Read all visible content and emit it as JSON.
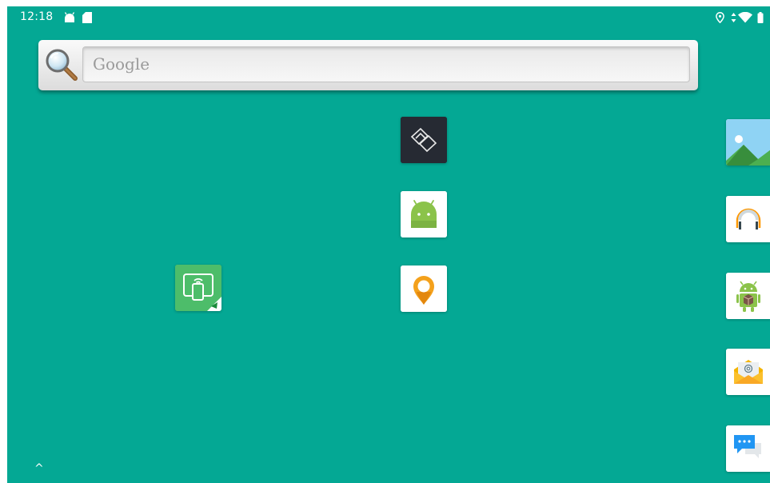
{
  "status_bar": {
    "time": "12:18",
    "left_icons": [
      "android-notification-icon",
      "sd-card-icon"
    ],
    "right_icons": [
      "location-icon",
      "data-arrows-icon",
      "wifi-icon",
      "battery-icon"
    ]
  },
  "search": {
    "placeholder": "Google",
    "icon": "magnifier-icon"
  },
  "apps": [
    {
      "icon": "mirror-squares-icon"
    },
    {
      "icon": "android-robot-icon"
    },
    {
      "icon": "screen-cast-icon"
    },
    {
      "icon": "map-pin-icon"
    }
  ],
  "dock": [
    {
      "icon": "gallery-icon"
    },
    {
      "icon": "headphones-icon"
    },
    {
      "icon": "android-package-icon"
    },
    {
      "icon": "email-icon"
    },
    {
      "icon": "messaging-icon"
    }
  ],
  "drawer_handle": "^",
  "colors": {
    "wallpaper": "#04a894",
    "status_text": "#ffffff"
  }
}
